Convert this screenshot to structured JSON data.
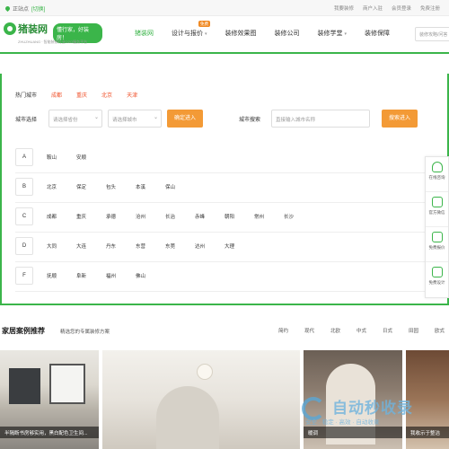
{
  "topbar": {
    "location_label": "正站点",
    "switch_label": "[切换]",
    "links": [
      "我要装修",
      "商户入驻",
      "会员登录",
      "免费注册"
    ]
  },
  "logo": {
    "name": "猪装网",
    "slogan": "懂行家，好装房！",
    "sub": "ZHUZHUANG · 智能装修行业O2O服务平台"
  },
  "nav": {
    "items": [
      {
        "label": "猪装网",
        "active": true
      },
      {
        "label": "设计与报价",
        "badge": "免费",
        "caret": "▾"
      },
      {
        "label": "装修效果图"
      },
      {
        "label": "装修公司"
      },
      {
        "label": "装修学堂",
        "caret": "▾"
      },
      {
        "label": "装修保障"
      }
    ],
    "search_placeholder": "装修攻略/问答"
  },
  "city": {
    "hot_label": "热门城市",
    "hot_cities": [
      "成都",
      "重庆",
      "北京",
      "天津"
    ],
    "select_label": "城市选择",
    "province_placeholder": "请选择省份",
    "city_placeholder": "请选择城市",
    "confirm_button": "确定进入",
    "search_label": "城市搜索",
    "search_placeholder": "直接输入城市名称",
    "search_button": "搜索进入",
    "rows": [
      {
        "letter": "A",
        "cities": [
          "鞍山",
          "安顺"
        ]
      },
      {
        "letter": "B",
        "cities": [
          "北京",
          "保定",
          "包头",
          "本溪",
          "保山"
        ]
      },
      {
        "letter": "C",
        "cities": [
          "成都",
          "重庆",
          "承德",
          "沧州",
          "长治",
          "赤峰",
          "朝阳",
          "常州",
          "长沙"
        ]
      },
      {
        "letter": "D",
        "cities": [
          "大同",
          "大连",
          "丹东",
          "东营",
          "东莞",
          "达州",
          "大理"
        ]
      },
      {
        "letter": "F",
        "cities": [
          "抚顺",
          "阜新",
          "福州",
          "佛山"
        ]
      }
    ]
  },
  "floatbar": {
    "items": [
      {
        "label": "在线咨询",
        "icon": "headset-icon"
      },
      {
        "label": "官方微信",
        "icon": "qrcode-icon"
      },
      {
        "label": "免费报价",
        "icon": "calculator-icon"
      },
      {
        "label": "免费设计",
        "icon": "design-icon"
      }
    ]
  },
  "cases": {
    "title": "家居案例推荐",
    "subtitle": "精选您的专属装修方案",
    "styles": [
      "简约",
      "现代",
      "北欧",
      "中式",
      "日式",
      "田园",
      "欧式"
    ],
    "photos": [
      {
        "caption": "半隔断书房够实用，黑白配色卫生间..."
      },
      {
        "caption": ""
      },
      {
        "caption": "暖调"
      },
      {
        "caption": "我收示于整洁"
      }
    ]
  },
  "watermark": {
    "title": "自动秒收录",
    "subtitle": "安全 · 稳定 · 高效 · 自动收录"
  }
}
